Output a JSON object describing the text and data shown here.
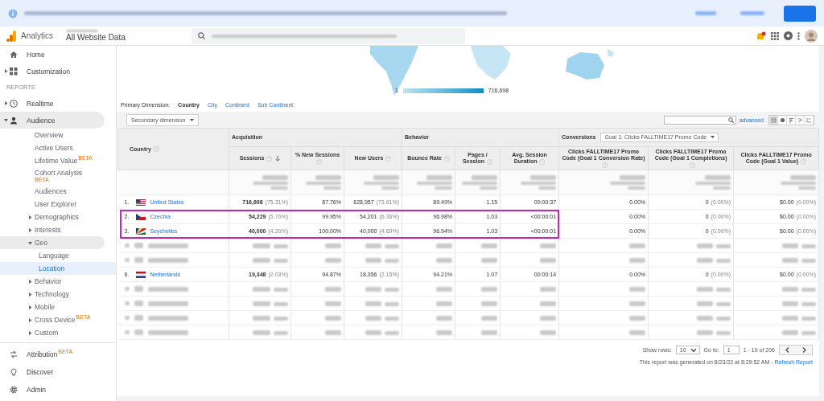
{
  "banner": {
    "redacted": true
  },
  "header": {
    "product": "Analytics",
    "account": "All Website Data",
    "notification": true
  },
  "sidebar": {
    "top": [
      {
        "label": "Home",
        "expandable": false
      },
      {
        "label": "Customization",
        "expandable": true
      }
    ],
    "section": "REPORTS",
    "reports": [
      {
        "label": "Realtime",
        "expanded": false
      },
      {
        "label": "Audience",
        "expanded": true,
        "children": [
          {
            "label": "Overview",
            "expandable": false
          },
          {
            "label": "Active Users",
            "expandable": false
          },
          {
            "label": "Lifetime Value",
            "badge": "BETA",
            "expandable": false
          },
          {
            "label": "Cohort Analysis",
            "badge": "BETA",
            "expandable": false
          },
          {
            "label": "Audiences",
            "expandable": false
          },
          {
            "label": "User Explorer",
            "expandable": false
          },
          {
            "label": "Demographics",
            "expandable": true,
            "expanded": false
          },
          {
            "label": "Interests",
            "expandable": true,
            "expanded": false
          },
          {
            "label": "Geo",
            "expandable": true,
            "expanded": true,
            "children": [
              {
                "label": "Language",
                "selected": false
              },
              {
                "label": "Location",
                "selected": true
              }
            ]
          },
          {
            "label": "Behavior",
            "expandable": true,
            "expanded": false
          },
          {
            "label": "Technology",
            "expandable": true,
            "expanded": false
          },
          {
            "label": "Mobile",
            "expandable": true,
            "expanded": false
          },
          {
            "label": "Cross Device",
            "badge": "BETA",
            "expandable": true,
            "expanded": false
          },
          {
            "label": "Custom",
            "expandable": true,
            "expanded": false
          }
        ]
      }
    ],
    "bottom": [
      {
        "label": "Attribution",
        "badge": "BETA"
      },
      {
        "label": "Discover"
      },
      {
        "label": "Admin"
      }
    ]
  },
  "map": {
    "legend_min": "1",
    "legend_max": "716,698"
  },
  "dimensions": {
    "label": "Primary Dimension:",
    "options": [
      {
        "label": "Country",
        "selected": true
      },
      {
        "label": "City",
        "selected": false
      },
      {
        "label": "Continent",
        "selected": false
      },
      {
        "label": "Sub Continent",
        "selected": false
      }
    ]
  },
  "secondary_dimension": "Secondary dimension",
  "toolbar": {
    "advanced": "advanced",
    "views": [
      {
        "selected": true
      },
      {
        "selected": false
      },
      {
        "selected": false
      },
      {
        "selected": false
      },
      {
        "selected": false
      }
    ]
  },
  "table": {
    "country_header": "Country",
    "groups": [
      "Acquisition",
      "Behavior"
    ],
    "conversions": {
      "label": "Conversions",
      "value": "Goal 1: Clicks FALLTIME17 Promo Code"
    },
    "columns": [
      {
        "label": "Sessions",
        "sorted": true
      },
      {
        "label": "% New Sessions",
        "sorted": false
      },
      {
        "label": "New Users",
        "sorted": false
      },
      {
        "label": "Bounce Rate",
        "sorted": false
      },
      {
        "label": "Pages / Session",
        "sorted": false
      },
      {
        "label": "Avg. Session Duration",
        "sorted": false
      },
      {
        "label": "Clicks FALLTIME17 Promo Code (Goal 1 Conversion Rate)",
        "sorted": false
      },
      {
        "label": "Clicks FALLTIME17 Promo Code (Goal 1 Completions)",
        "sorted": false
      },
      {
        "label": "Clicks FALLTIME17 Promo Code (Goal 1 Value)",
        "sorted": false
      }
    ],
    "summary_redacted": true,
    "rows": [
      {
        "kind": "data",
        "index": "1.",
        "country": "United States",
        "highlighted": false,
        "cells": [
          {
            "value": "716,698",
            "share": "(75.31%)"
          },
          {
            "value": "87.76%"
          },
          {
            "value": "628,957",
            "share": "(73.61%)"
          },
          {
            "value": "89.49%"
          },
          {
            "value": "1.15"
          },
          {
            "value": "00:00:37"
          },
          {
            "value": "0.00%"
          },
          {
            "value": "0",
            "share": "(0.00%)"
          },
          {
            "value": "$0.00",
            "share": "(0.00%)"
          }
        ]
      },
      {
        "kind": "data",
        "index": "2.",
        "country": "Czechia",
        "highlighted": true,
        "cells": [
          {
            "value": "54,229",
            "share": "(5.70%)"
          },
          {
            "value": "99.95%"
          },
          {
            "value": "54,201",
            "share": "(6.36%)"
          },
          {
            "value": "96.98%"
          },
          {
            "value": "1.03"
          },
          {
            "value": "<00:00:01"
          },
          {
            "value": "0.00%"
          },
          {
            "value": "0",
            "share": "(0.00%)"
          },
          {
            "value": "$0.00",
            "share": "(0.00%)"
          }
        ]
      },
      {
        "kind": "data",
        "index": "3.",
        "country": "Seychelles",
        "highlighted": true,
        "cells": [
          {
            "value": "40,000",
            "share": "(4.20%)"
          },
          {
            "value": "100.00%"
          },
          {
            "value": "40,000",
            "share": "(4.69%)"
          },
          {
            "value": "96.94%"
          },
          {
            "value": "1.03"
          },
          {
            "value": "<00:00:01"
          },
          {
            "value": "0.00%"
          },
          {
            "value": "0",
            "share": "(0.00%)"
          },
          {
            "value": "$0.00",
            "share": "(0.00%)"
          }
        ]
      },
      {
        "kind": "redacted"
      },
      {
        "kind": "redacted"
      },
      {
        "kind": "data",
        "index": "6.",
        "country": "Netherlands",
        "highlighted": false,
        "cells": [
          {
            "value": "19,348",
            "share": "(2.03%)"
          },
          {
            "value": "94.87%"
          },
          {
            "value": "18,356",
            "share": "(2.15%)"
          },
          {
            "value": "94.21%"
          },
          {
            "value": "1.07"
          },
          {
            "value": "00:00:14"
          },
          {
            "value": "0.00%"
          },
          {
            "value": "0",
            "share": "(0.00%)"
          },
          {
            "value": "$0.00",
            "share": "(0.00%)"
          }
        ]
      },
      {
        "kind": "redacted"
      },
      {
        "kind": "redacted"
      },
      {
        "kind": "redacted"
      },
      {
        "kind": "redacted"
      }
    ]
  },
  "footer": {
    "show_rows_label": "Show rows:",
    "rows_value": "10",
    "goto_label": "Go to:",
    "goto_value": "1",
    "range": "1 - 10 of 206",
    "generated": "This report was generated on 8/23/22 at 8:29:52 AM - ",
    "refresh": "Refresh Report"
  }
}
